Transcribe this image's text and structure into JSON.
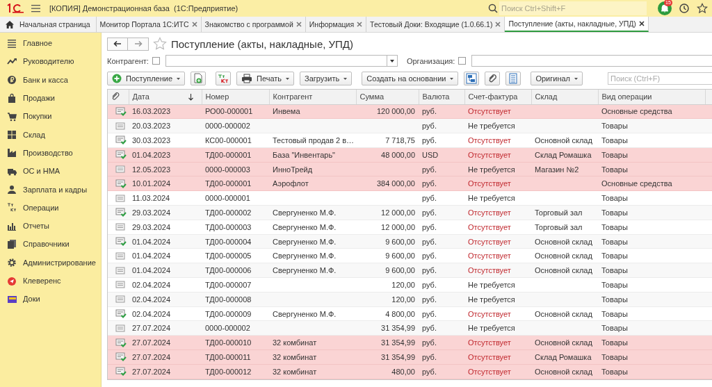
{
  "window": {
    "title": "[КОПИЯ] Демонстрационная база  (1С:Предприятие)"
  },
  "global_search": {
    "placeholder": "Поиск Ctrl+Shift+F"
  },
  "notifications": {
    "count": "15"
  },
  "tabs": [
    {
      "label": "Начальная страница",
      "kind": "home",
      "selected": false
    },
    {
      "label": "Монитор Портала 1С:ИТС",
      "kind": "doc",
      "selected": false
    },
    {
      "label": "Знакомство с программой",
      "kind": "doc",
      "selected": false
    },
    {
      "label": "Информация",
      "kind": "doc",
      "selected": false
    },
    {
      "label": "Тестовый Доки: Входящие (1.0.66.1)",
      "kind": "doc",
      "selected": false
    },
    {
      "label": "Поступление (акты, накладные, УПД)",
      "kind": "doc",
      "selected": true
    }
  ],
  "sidebar": {
    "items": [
      {
        "label": "Главное"
      },
      {
        "label": "Руководителю"
      },
      {
        "label": "Банк и касса"
      },
      {
        "label": "Продажи"
      },
      {
        "label": "Покупки"
      },
      {
        "label": "Склад"
      },
      {
        "label": "Производство"
      },
      {
        "label": "ОС и НМА"
      },
      {
        "label": "Зарплата и кадры"
      },
      {
        "label": "Операции"
      },
      {
        "label": "Отчеты"
      },
      {
        "label": "Справочники"
      },
      {
        "label": "Администрирование"
      },
      {
        "label": "Клеверенс"
      },
      {
        "label": "Доки"
      }
    ]
  },
  "form": {
    "title": "Поступление (акты, накладные, УПД)",
    "filters": [
      {
        "label": "Контрагент:",
        "checked": false
      },
      {
        "label": "Организация:",
        "checked": false
      }
    ],
    "toolbar": [
      {
        "kind": "menu",
        "label": "Поступление"
      },
      {
        "kind": "icon"
      },
      {
        "kind": "icon"
      },
      {
        "kind": "menu",
        "label": "Печать"
      },
      {
        "kind": "menu",
        "label": "Загрузить"
      },
      {
        "kind": "menu",
        "label": "Создать на основании"
      },
      {
        "kind": "icon"
      },
      {
        "kind": "icon"
      },
      {
        "kind": "icon"
      },
      {
        "kind": "menu",
        "label": "Оригинал"
      }
    ],
    "search": {
      "placeholder": "Поиск (Ctrl+F)"
    }
  },
  "table": {
    "columns": [
      "Дата",
      "Номер",
      "Контрагент",
      "Сумма",
      "Валюта",
      "Счет-фактура",
      "Склад",
      "Вид операции"
    ],
    "rows": [
      {
        "highlighted": true,
        "posted": true,
        "invoice_missing": true,
        "cells": [
          "16.03.2023",
          "РО00-000001",
          "Инвема",
          "120 000,00",
          "руб.",
          "Отсутствует",
          "",
          "Основные средства"
        ]
      },
      {
        "highlighted": false,
        "posted": false,
        "invoice_missing": false,
        "cells": [
          "20.03.2023",
          "0000-000002",
          "",
          "",
          "руб.",
          "Не требуется",
          "",
          "Товары"
        ]
      },
      {
        "highlighted": false,
        "posted": true,
        "invoice_missing": true,
        "cells": [
          "30.03.2023",
          "КС00-000001",
          "Тестовый продав 2 в…",
          "7 718,75",
          "руб.",
          "Отсутствует",
          "Основной склад",
          "Товары"
        ]
      },
      {
        "highlighted": true,
        "posted": true,
        "invoice_missing": true,
        "cells": [
          "01.04.2023",
          "ТД00-000001",
          "База \"Инвентарь\"",
          "48 000,00",
          "USD",
          "Отсутствует",
          "Склад Ромашка",
          "Товары"
        ]
      },
      {
        "highlighted": true,
        "posted": false,
        "invoice_missing": false,
        "cells": [
          "12.05.2023",
          "0000-000003",
          "ИнноТрейд",
          "",
          "руб.",
          "Не требуется",
          "Магазин №2",
          "Товары"
        ]
      },
      {
        "highlighted": true,
        "posted": true,
        "invoice_missing": true,
        "cells": [
          "10.01.2024",
          "ТД00-000001",
          "Аэрофлот",
          "384 000,00",
          "руб.",
          "Отсутствует",
          "",
          "Основные средства"
        ]
      },
      {
        "highlighted": false,
        "posted": false,
        "invoice_missing": false,
        "cells": [
          "11.03.2024",
          "0000-000001",
          "",
          "",
          "руб.",
          "Не требуется",
          "",
          "Товары"
        ]
      },
      {
        "highlighted": false,
        "posted": true,
        "invoice_missing": true,
        "cells": [
          "29.03.2024",
          "ТД00-000002",
          "Свергуненко М.Ф.",
          "12 000,00",
          "руб.",
          "Отсутствует",
          "Торговый зал",
          "Товары"
        ]
      },
      {
        "highlighted": false,
        "posted": false,
        "invoice_missing": true,
        "cells": [
          "29.03.2024",
          "ТД00-000003",
          "Свергуненко М.Ф.",
          "12 000,00",
          "руб.",
          "Отсутствует",
          "Торговый зал",
          "Товары"
        ]
      },
      {
        "highlighted": false,
        "posted": true,
        "invoice_missing": true,
        "cells": [
          "01.04.2024",
          "ТД00-000004",
          "Свергуненко М.Ф.",
          "9 600,00",
          "руб.",
          "Отсутствует",
          "Основной склад",
          "Товары"
        ]
      },
      {
        "highlighted": false,
        "posted": false,
        "invoice_missing": true,
        "cells": [
          "01.04.2024",
          "ТД00-000005",
          "Свергуненко М.Ф.",
          "9 600,00",
          "руб.",
          "Отсутствует",
          "Основной склад",
          "Товары"
        ]
      },
      {
        "highlighted": false,
        "posted": false,
        "invoice_missing": true,
        "cells": [
          "01.04.2024",
          "ТД00-000006",
          "Свергуненко М.Ф.",
          "9 600,00",
          "руб.",
          "Отсутствует",
          "Основной склад",
          "Товары"
        ]
      },
      {
        "highlighted": false,
        "posted": false,
        "invoice_missing": false,
        "cells": [
          "02.04.2024",
          "ТД00-000007",
          "",
          "120,00",
          "руб.",
          "Не требуется",
          "",
          "Товары"
        ]
      },
      {
        "highlighted": false,
        "posted": false,
        "invoice_missing": false,
        "cells": [
          "02.04.2024",
          "ТД00-000008",
          "",
          "120,00",
          "руб.",
          "Не требуется",
          "",
          "Товары"
        ]
      },
      {
        "highlighted": false,
        "posted": true,
        "invoice_missing": true,
        "cells": [
          "02.04.2024",
          "ТД00-000009",
          "Свергуненко М.Ф.",
          "4 800,00",
          "руб.",
          "Отсутствует",
          "Основной склад",
          "Товары"
        ]
      },
      {
        "highlighted": false,
        "posted": false,
        "invoice_missing": false,
        "cells": [
          "27.07.2024",
          "0000-000002",
          "",
          "31 354,99",
          "руб.",
          "Не требуется",
          "",
          "Товары"
        ]
      },
      {
        "highlighted": true,
        "posted": true,
        "invoice_missing": true,
        "cells": [
          "27.07.2024",
          "ТД00-000010",
          "32 комбинат",
          "31 354,99",
          "руб.",
          "Отсутствует",
          "Основной склад",
          "Товары"
        ]
      },
      {
        "highlighted": true,
        "posted": true,
        "invoice_missing": true,
        "cells": [
          "27.07.2024",
          "ТД00-000011",
          "32 комбинат",
          "31 354,99",
          "руб.",
          "Отсутствует",
          "Склад Ромашка",
          "Товары"
        ]
      },
      {
        "highlighted": true,
        "posted": true,
        "invoice_missing": true,
        "cells": [
          "27.07.2024",
          "ТД00-000012",
          "32 комбинат",
          "480,00",
          "руб.",
          "Отсутствует",
          "Основной склад",
          "Товары"
        ]
      }
    ]
  }
}
